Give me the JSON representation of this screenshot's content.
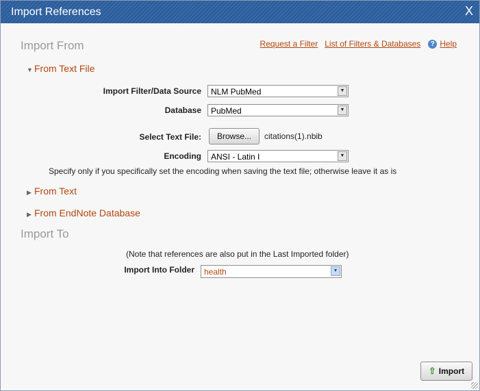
{
  "window": {
    "title": "Import References",
    "close_label": "X"
  },
  "import_from": {
    "heading": "Import From",
    "links": {
      "request_filter": "Request a Filter",
      "filters_databases": "List of Filters & Databases",
      "help": "Help"
    },
    "from_text_file": {
      "label": "From Text File",
      "filter_label": "Import Filter/Data Source",
      "filter_value": "NLM PubMed",
      "database_label": "Database",
      "database_value": "PubMed",
      "select_file_label": "Select Text File:",
      "browse_label": "Browse...",
      "file_name": "citations(1).nbib",
      "encoding_label": "Encoding",
      "encoding_value": "ANSI - Latin I",
      "encoding_note": "Specify only if you specifically set the encoding when saving the text file; otherwise leave it as is"
    },
    "from_text": "From Text",
    "from_endnote": "From EndNote Database"
  },
  "import_to": {
    "heading": "Import To",
    "note": "(Note that references are also put in the Last Imported folder)",
    "folder_label": "Import Into Folder",
    "folder_value": "health"
  },
  "import_button": "Import",
  "colors": {
    "title_bar": "#2a5d9c",
    "link": "#b3470e",
    "heading": "#999999",
    "folder_text": "#b3470e"
  }
}
